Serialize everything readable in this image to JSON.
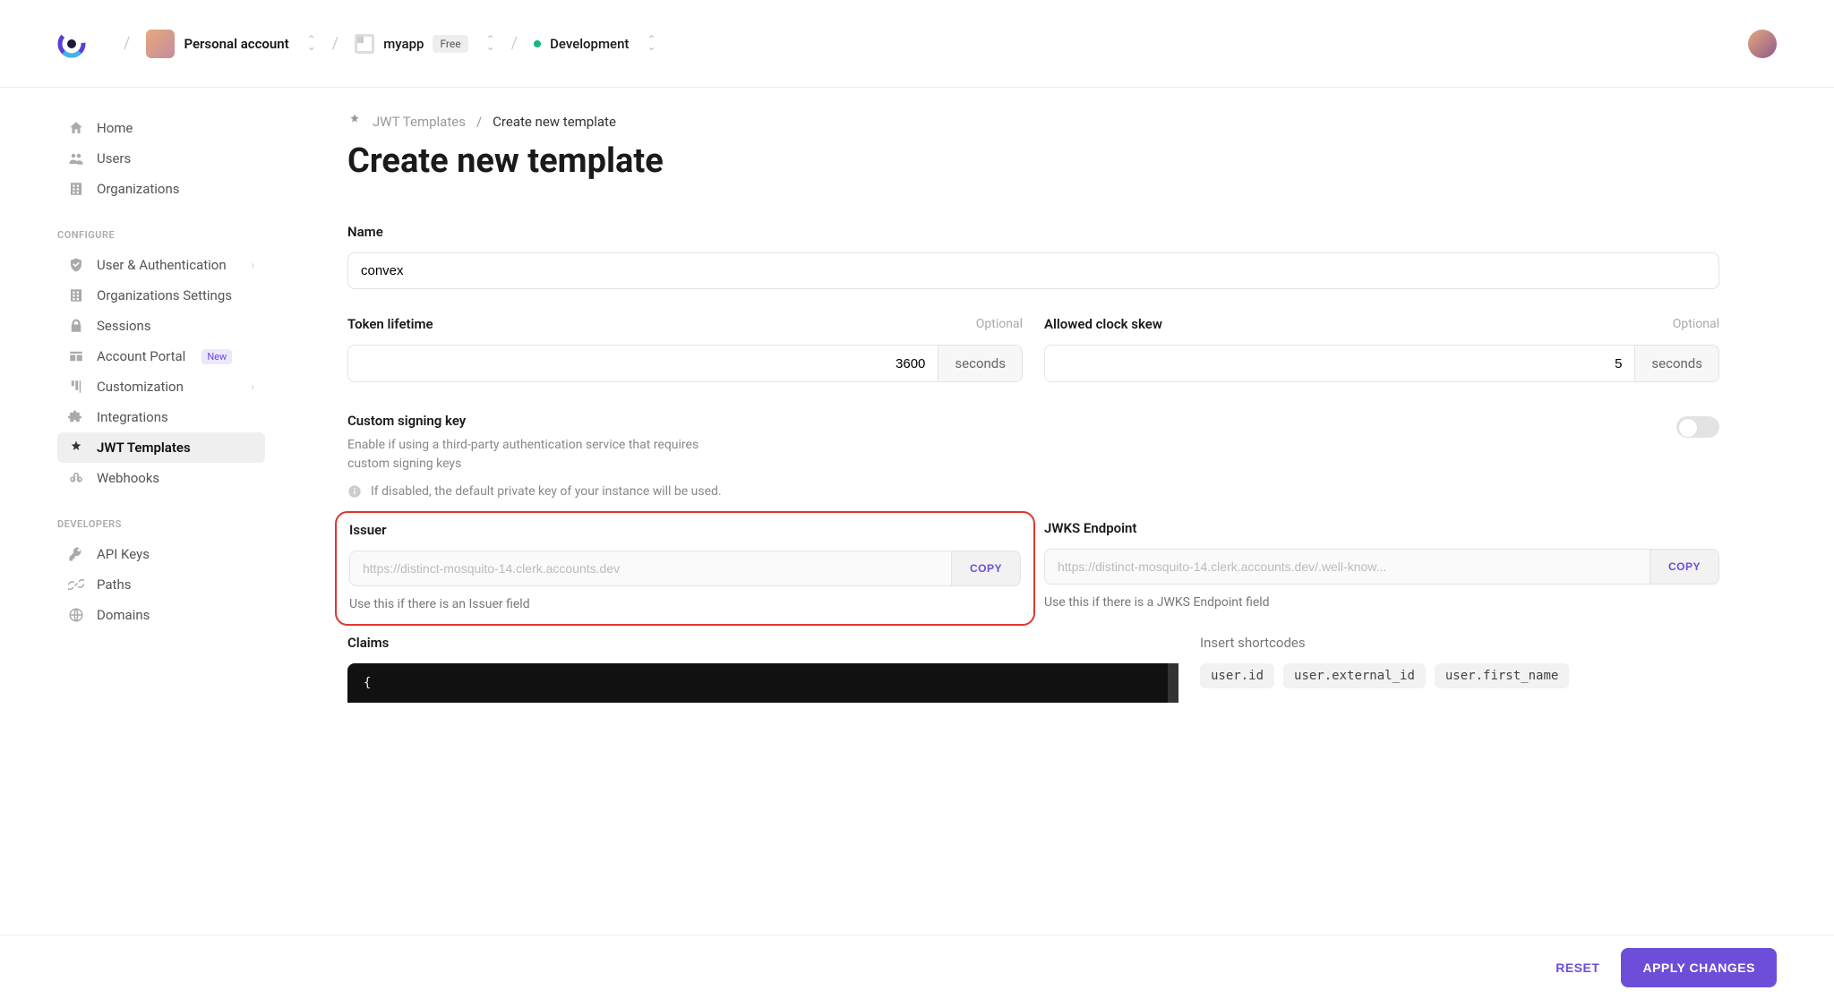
{
  "top": {
    "workspace": "Personal account",
    "app": "myapp",
    "tier": "Free",
    "env": "Development"
  },
  "sidebar": {
    "main": [
      {
        "label": "Home",
        "icon": "home-icon"
      },
      {
        "label": "Users",
        "icon": "users-icon"
      },
      {
        "label": "Organizations",
        "icon": "org-icon"
      }
    ],
    "configure_heading": "CONFIGURE",
    "configure": [
      {
        "label": "User & Authentication",
        "icon": "shield-icon",
        "chev": true
      },
      {
        "label": "Organizations Settings",
        "icon": "org-icon"
      },
      {
        "label": "Sessions",
        "icon": "lock-icon"
      },
      {
        "label": "Account Portal",
        "icon": "portal-icon",
        "badge": "New"
      },
      {
        "label": "Customization",
        "icon": "palette-icon",
        "chev": true
      },
      {
        "label": "Integrations",
        "icon": "puzzle-icon"
      },
      {
        "label": "JWT Templates",
        "icon": "jwt-icon",
        "active": true
      },
      {
        "label": "Webhooks",
        "icon": "webhooks-icon"
      }
    ],
    "developers_heading": "DEVELOPERS",
    "developers": [
      {
        "label": "API Keys",
        "icon": "key-icon"
      },
      {
        "label": "Paths",
        "icon": "link-icon"
      },
      {
        "label": "Domains",
        "icon": "globe-icon"
      }
    ]
  },
  "breadcrumb": {
    "parent": "JWT Templates",
    "current": "Create new template"
  },
  "title": "Create new template",
  "fields": {
    "name_label": "Name",
    "name_value": "convex",
    "token_label": "Token lifetime",
    "token_value": "3600",
    "token_unit": "seconds",
    "skew_label": "Allowed clock skew",
    "skew_value": "5",
    "skew_unit": "seconds",
    "optional": "Optional",
    "csk_label": "Custom signing key",
    "csk_desc": "Enable if using a third-party authentication service that requires custom signing keys",
    "csk_info": "If disabled, the default private key of your instance will be used.",
    "issuer_label": "Issuer",
    "issuer_value": "https://distinct-mosquito-14.clerk.accounts.dev",
    "issuer_hint": "Use this if there is an Issuer field",
    "jwks_label": "JWKS Endpoint",
    "jwks_value": "https://distinct-mosquito-14.clerk.accounts.dev/.well-know...",
    "jwks_hint": "Use this if there is a JWKS Endpoint field",
    "copy": "COPY",
    "claims_label": "Claims",
    "claims_code": "{",
    "shortcodes_label": "Insert shortcodes",
    "shortcodes": [
      "user.id",
      "user.external_id",
      "user.first_name"
    ]
  },
  "footer": {
    "reset": "RESET",
    "apply": "APPLY CHANGES"
  }
}
